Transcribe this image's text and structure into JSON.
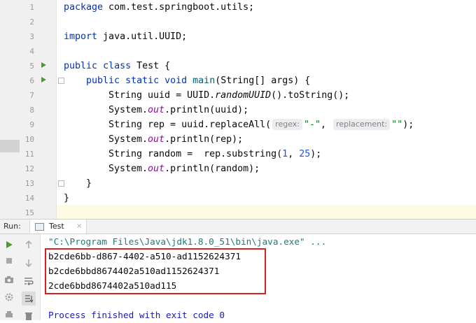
{
  "editor": {
    "line_numbers": [
      "1",
      "2",
      "3",
      "4",
      "5",
      "6",
      "7",
      "8",
      "9",
      "10",
      "11",
      "12",
      "13",
      "14",
      "15"
    ],
    "code": {
      "l1": {
        "kw": "package",
        "rest": " com.test.springboot.utils;"
      },
      "l3": {
        "kw": "import",
        "rest": " java.util.UUID;"
      },
      "l5": {
        "kw1": "public",
        "kw2": "class",
        "rest": " Test {"
      },
      "l6": {
        "kw1": "public",
        "kw2": "static",
        "kw3": "void",
        "name": "main",
        "rest": "(String[] args) {"
      },
      "l7": {
        "a": "String uuid = UUID.",
        "m": "randomUUID",
        "b": "().toString();"
      },
      "l8": {
        "a": "System.",
        "f": "out",
        "b": ".println(uuid);"
      },
      "l9": {
        "a": "String rep = uuid.replaceAll(",
        "hint1": "regex:",
        "s1": "\"-\"",
        "sep": ", ",
        "hint2": "replacement:",
        "s2": "\"\"",
        "b": ");"
      },
      "l10": {
        "a": "System.",
        "f": "out",
        "b": ".println(rep);"
      },
      "l11": {
        "a": "String random =  rep.substring(",
        "n1": "1",
        "sep": ", ",
        "n2": "25",
        "b": ");"
      },
      "l12": {
        "a": "System.",
        "f": "out",
        "b": ".println(random);"
      },
      "l13": "}",
      "l14": "}"
    }
  },
  "run_panel": {
    "title": "Run:",
    "tab_label": "Test",
    "tab_close": "×",
    "toolbar_icons": [
      "run-icon",
      "up-arrow-icon",
      "stop-icon",
      "down-arrow-icon",
      "camera-icon",
      "soft-wrap-icon",
      "settings-icon",
      "scroll-to-end-icon",
      "print-icon",
      "trash-icon"
    ],
    "output": {
      "command": "\"C:\\Program Files\\Java\\jdk1.8.0_51\\bin\\java.exe\" ...",
      "line1": "b2cde6bb-d867-4402-a510-ad1152624371",
      "line2": "b2cde6bbd8674402a510ad1152624371",
      "line3": "2cde6bbd8674402a510ad115",
      "process": "Process finished with exit code 0"
    }
  },
  "colors": {
    "keyword": "#0033b3",
    "field": "#871094",
    "number": "#1750eb",
    "string": "#067d17",
    "highlight_border": "#d42222",
    "run_green": "#4e9a2e"
  }
}
